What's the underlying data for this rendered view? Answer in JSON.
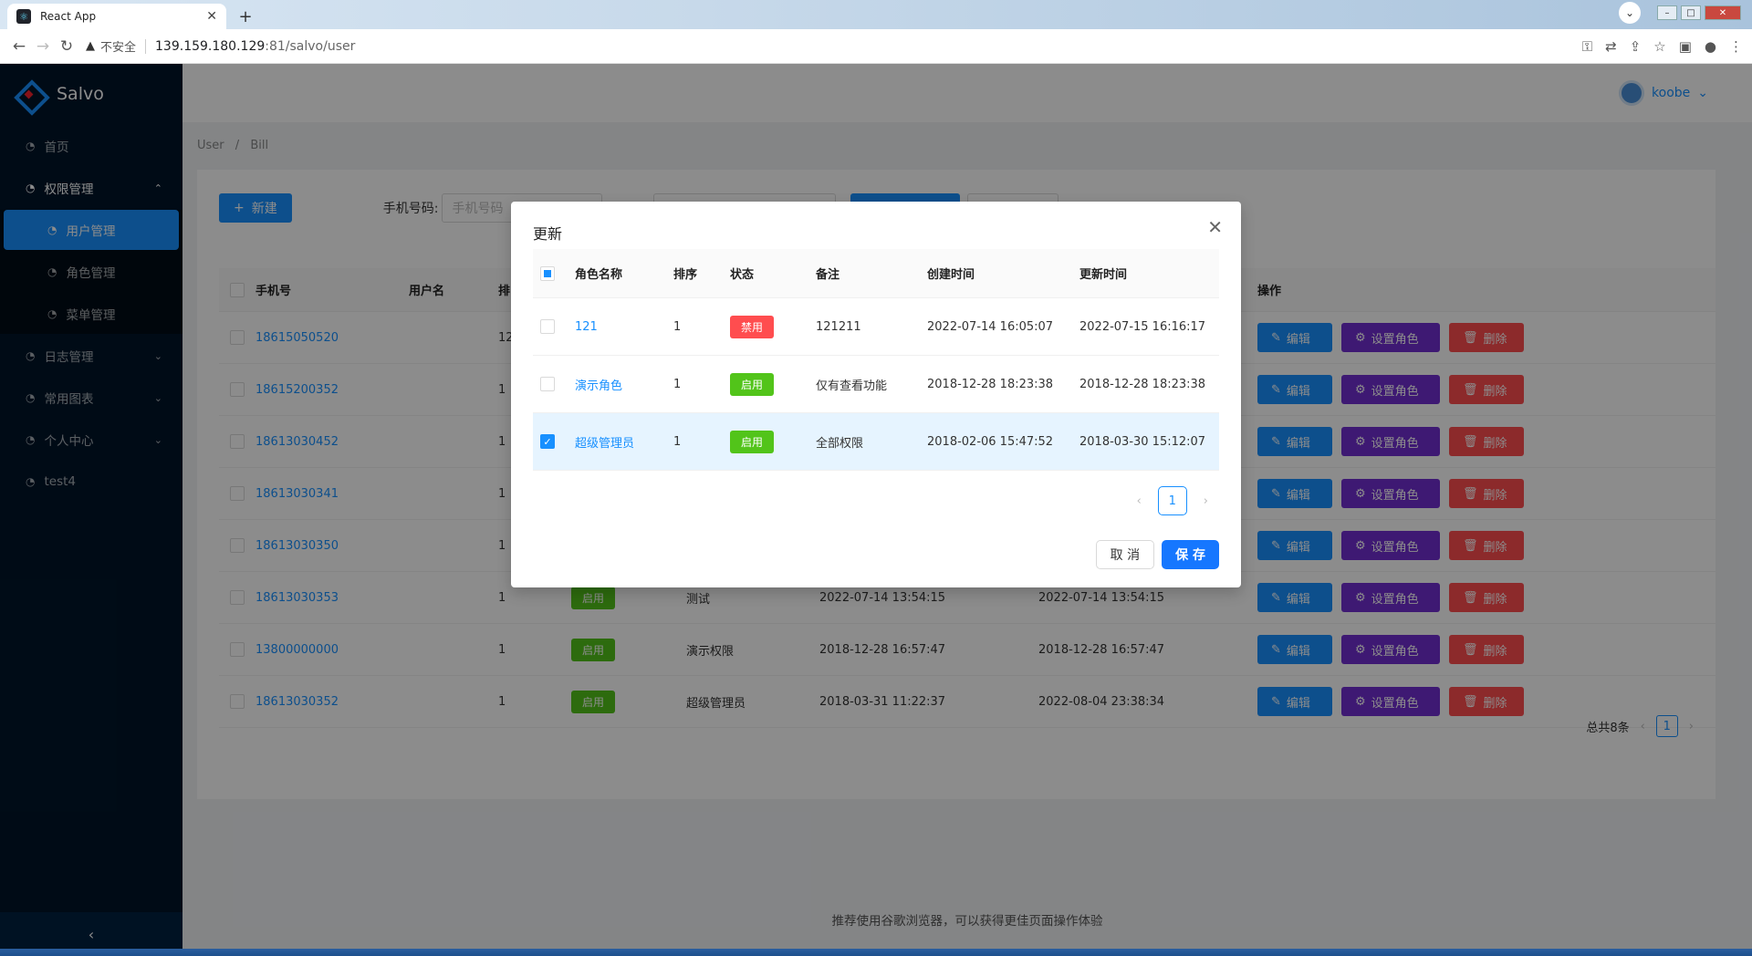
{
  "browser": {
    "tab_title": "React App",
    "insecure_label": "不安全",
    "url_host": "139.159.180.129",
    "url_path": ":81/salvo/user"
  },
  "app": {
    "name": "Salvo",
    "user": "koobe"
  },
  "sidebar": {
    "items": [
      {
        "label": "首页"
      },
      {
        "label": "权限管理"
      },
      {
        "label": "用户管理"
      },
      {
        "label": "角色管理"
      },
      {
        "label": "菜单管理"
      },
      {
        "label": "日志管理"
      },
      {
        "label": "常用图表"
      },
      {
        "label": "个人中心"
      },
      {
        "label": "test4"
      }
    ]
  },
  "breadcrumb": {
    "items": [
      "User",
      "/",
      "Bill"
    ]
  },
  "toolbar": {
    "new_label": "新建",
    "phone_label": "手机号码:",
    "phone_placeholder": "手机号码"
  },
  "table": {
    "headers": {
      "phone": "手机号",
      "username": "用户名",
      "sort": "排",
      "ops": "操作"
    },
    "rows": [
      {
        "phone": "18615050520",
        "sort": "12",
        "status": "",
        "note": "",
        "created": "",
        "updated": ""
      },
      {
        "phone": "18615200352",
        "sort": "1",
        "status": "",
        "note": "",
        "created": "",
        "updated": ""
      },
      {
        "phone": "18613030452",
        "sort": "1",
        "status": "",
        "note": "",
        "created": "",
        "updated": ""
      },
      {
        "phone": "18613030341",
        "sort": "1",
        "status": "",
        "note": "",
        "created": "",
        "updated": ""
      },
      {
        "phone": "18613030350",
        "sort": "1",
        "status": "",
        "note": "",
        "created": "",
        "updated": ""
      },
      {
        "phone": "18613030353",
        "sort": "1",
        "status": "启用",
        "note": "测试",
        "created": "2022-07-14 13:54:15",
        "updated": "2022-07-14 13:54:15"
      },
      {
        "phone": "13800000000",
        "sort": "1",
        "status": "启用",
        "note": "演示权限",
        "created": "2018-12-28 16:57:47",
        "updated": "2018-12-28 16:57:47"
      },
      {
        "phone": "18613030352",
        "sort": "1",
        "status": "启用",
        "note": "超级管理员",
        "created": "2018-03-31 11:22:37",
        "updated": "2022-08-04 23:38:34"
      }
    ],
    "ops": {
      "edit": "编辑",
      "set_role": "设置角色",
      "delete": "删除"
    },
    "total": "总共8条",
    "page": "1"
  },
  "modal": {
    "title": "更新",
    "headers": {
      "name": "角色名称",
      "sort": "排序",
      "status": "状态",
      "note": "备注",
      "created": "创建时间",
      "updated": "更新时间"
    },
    "rows": [
      {
        "name": "121",
        "sort": "1",
        "status": "禁用",
        "note": "121211",
        "created": "2022-07-14 16:05:07",
        "updated": "2022-07-15 16:16:17",
        "checked": false
      },
      {
        "name": "演示角色",
        "sort": "1",
        "status": "启用",
        "note": "仅有查看功能",
        "created": "2018-12-28 18:23:38",
        "updated": "2018-12-28 18:23:38",
        "checked": false
      },
      {
        "name": "超级管理员",
        "sort": "1",
        "status": "启用",
        "note": "全部权限",
        "created": "2018-02-06 15:47:52",
        "updated": "2018-03-30 15:12:07",
        "checked": true
      }
    ],
    "page": "1",
    "cancel": "取 消",
    "save": "保 存"
  },
  "footer": {
    "text": "推荐使用谷歌浏览器，可以获得更佳页面操作体验"
  },
  "colors": {
    "primary": "#1890ff",
    "purple": "#722ed1",
    "danger": "#ff4d4f",
    "success": "#52c41a",
    "sider": "#001529"
  }
}
